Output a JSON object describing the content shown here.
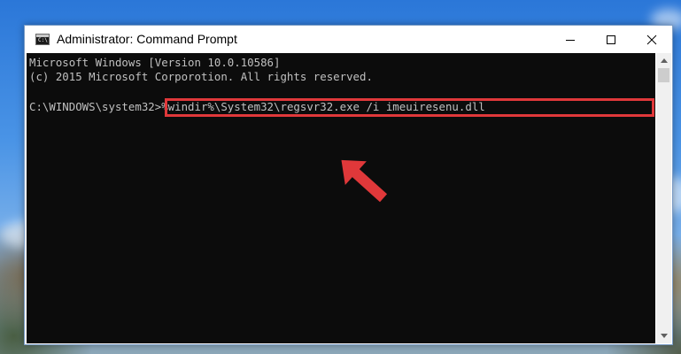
{
  "window": {
    "title": "Administrator: Command Prompt",
    "icon": "cmd-icon",
    "icon_text": "C:\\"
  },
  "controls": {
    "minimize": "minimize-icon",
    "maximize": "maximize-icon",
    "close": "close-icon"
  },
  "console": {
    "lines": [
      "Microsoft Windows [Version 10.0.10586]",
      "(c) 2015 Microsoft Corporotion. All rights reserved."
    ],
    "prompt": "C:\\WINDOWS\\system32>",
    "command": "%windir%\\System32\\regsvr32.exe /i imeuiresenu.dll"
  },
  "annotation": {
    "highlight_color": "#e0383a",
    "arrow_color": "#e0383a"
  },
  "colors": {
    "console_bg": "#0c0c0c",
    "console_text": "#c0c0c0"
  }
}
